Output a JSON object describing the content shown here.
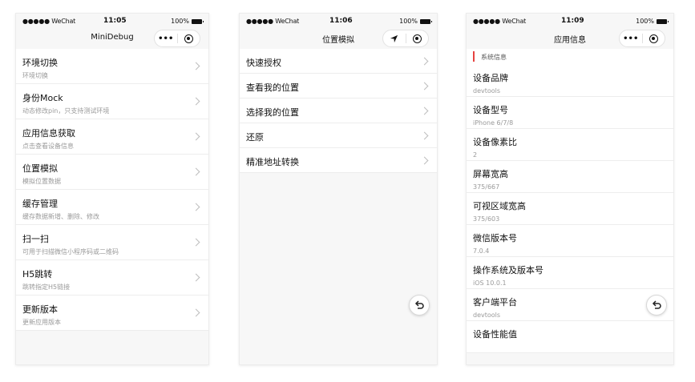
{
  "screens": [
    {
      "status": {
        "carrier": "●●●●● WeChat",
        "time": "11:05",
        "battery": "100%"
      },
      "title": "MiniDebug",
      "capsule": {
        "more": "•••"
      },
      "items": [
        {
          "title": "环境切换",
          "subtitle": "环境切换"
        },
        {
          "title": "身份Mock",
          "subtitle": "动态修改pin，只支持测试环境"
        },
        {
          "title": "应用信息获取",
          "subtitle": "点击查看设备信息"
        },
        {
          "title": "位置模拟",
          "subtitle": "模拟位置数据"
        },
        {
          "title": "缓存管理",
          "subtitle": "缓存数据新增、删除、修改"
        },
        {
          "title": "扫一扫",
          "subtitle": "可用于扫描微信小程序码或二维码"
        },
        {
          "title": "H5跳转",
          "subtitle": "跳转指定H5链接"
        },
        {
          "title": "更新版本",
          "subtitle": "更新应用版本"
        }
      ]
    },
    {
      "status": {
        "carrier": "●●●●● WeChat",
        "time": "11:06",
        "battery": "100%"
      },
      "title": "位置模拟",
      "items": [
        {
          "title": "快速授权"
        },
        {
          "title": "查看我的位置"
        },
        {
          "title": "选择我的位置"
        },
        {
          "title": "还原"
        },
        {
          "title": "精准地址转换"
        }
      ]
    },
    {
      "status": {
        "carrier": "●●●●● WeChat",
        "time": "11:09",
        "battery": "100%"
      },
      "title": "应用信息",
      "capsule": {
        "more": "•••"
      },
      "section": "系统信息",
      "items": [
        {
          "title": "设备品牌",
          "subtitle": "devtools"
        },
        {
          "title": "设备型号",
          "subtitle": "iPhone 6/7/8"
        },
        {
          "title": "设备像素比",
          "subtitle": "2"
        },
        {
          "title": "屏幕宽高",
          "subtitle": "375/667"
        },
        {
          "title": "可视区域宽高",
          "subtitle": "375/603"
        },
        {
          "title": "微信版本号",
          "subtitle": "7.0.4"
        },
        {
          "title": "操作系统及版本号",
          "subtitle": "iOS 10.0.1"
        },
        {
          "title": "客户端平台",
          "subtitle": "devtools"
        },
        {
          "title": "设备性能值",
          "subtitle": ""
        }
      ]
    }
  ],
  "icons": {
    "back": "back-arrow-icon",
    "location": "location-arrow-icon",
    "target": "record-target-icon"
  },
  "colors": {
    "accent": "#e64340"
  }
}
